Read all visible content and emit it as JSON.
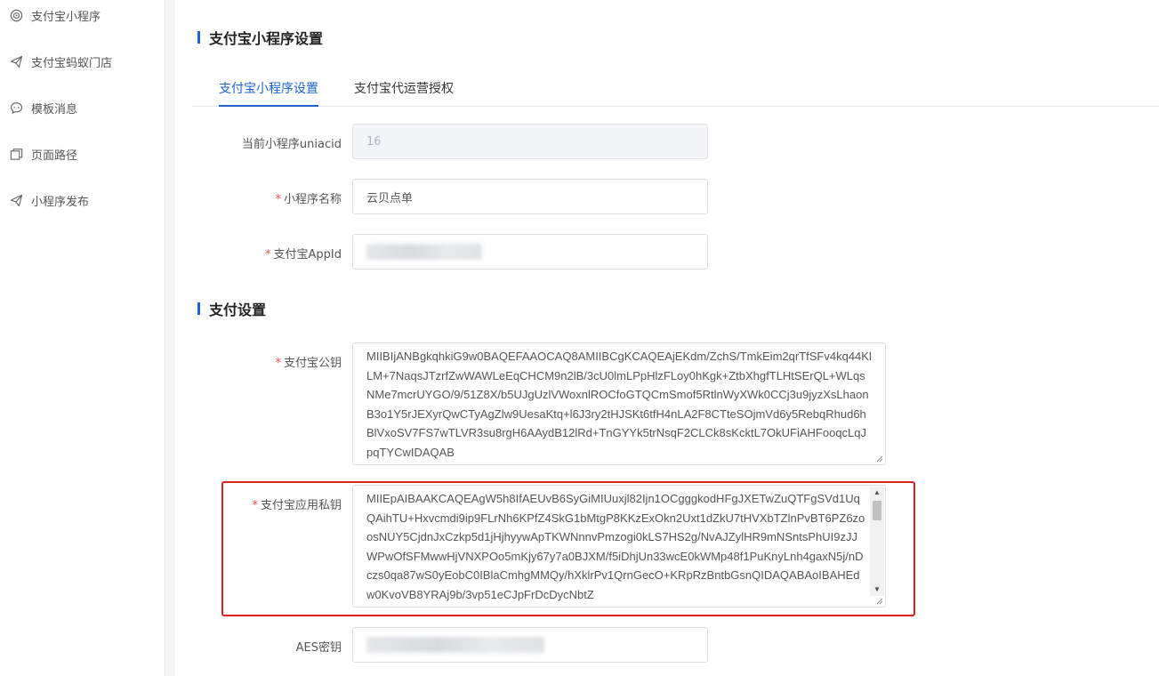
{
  "sidebar": {
    "items": [
      {
        "label": "支付宝小程序",
        "icon": "alipay-miniapp-icon"
      },
      {
        "label": "支付宝蚂蚁门店",
        "icon": "paper-plane-icon"
      },
      {
        "label": "模板消息",
        "icon": "chat-bubble-icon"
      },
      {
        "label": "页面路径",
        "icon": "pages-icon"
      },
      {
        "label": "小程序发布",
        "icon": "paper-plane-icon"
      }
    ]
  },
  "main": {
    "section1_title": "支付宝小程序设置",
    "tabs": [
      {
        "label": "支付宝小程序设置",
        "active": true
      },
      {
        "label": "支付宝代运营授权",
        "active": false
      }
    ],
    "fields": {
      "uniacid": {
        "label": "当前小程序uniacid",
        "value": "16"
      },
      "name": {
        "label": "小程序名称",
        "required": "*",
        "value": "云贝点单"
      },
      "appid": {
        "label": "支付宝AppId",
        "required": "*"
      }
    },
    "section2_title": "支付设置",
    "pay": {
      "public_key": {
        "label": "支付宝公钥",
        "required": "*",
        "value": "MIIBIjANBgkqhkiG9w0BAQEFAAOCAQ8AMIIBCgKCAQEAjEKdm/ZchS/TmkEim2qrTfSFv4kq44KlLM+7NaqsJTzrfZwWAWLeEqCHCM9n2lB/3cU0lmLPpHlzFLoy0hKgk+ZtbXhgfTLHtSErQL+WLqsNMe7mcrUYGO/9/51Z8X/b5UJgUzlVWoxnlROCfoGTQCmSmof5RtlnWyXWk0CCj3u9jyzXsLhaonB3o1Y5rJEXyrQwCTyAgZlw9UesaKtq+l6J3ry2tHJSKt6tfH4nLA2F8CTteSOjmVd6y5RebqRhud6hBlVxoSV7FS7wTLVR3su8rgH6AAydB12lRd+TnGYYk5trNsqF2CLCk8sKcktL7OkUFiAHFooqcLqJpqTYCwIDAQAB"
      },
      "private_key": {
        "label": "支付宝应用私钥",
        "required": "*",
        "value": "MIIEpAIBAAKCAQEAgW5h8IfAEUvB6SyGiMIUuxjl82Ijn1OCgggkodHFgJXETwZuQTFgSVd1UqQAihTU+Hxvcmdi9ip9FLrNh6KPfZ4SkG1bMtgP8KKzExOkn2Uxt1dZkU7tHVXbTZlnPvBT6PZ6zoosNUY5CjdnJxCzkp5d1jHjhyywApTKWNnnvPmzogi0kLS7HS2g/NvAJZylHR9mNSntsPhUI9zJJWPwOfSFMwwHjVNXPOo5mKjy67y7a0BJXM/f5iDhjUn33wcE0kWMp48f1PuKnyLnh4gaxN5j/nDczs0qa87wS0yEobC0IBlaCmhgMMQy/hXklrPv1QrnGecO+KRpRzBntbGsnQIDAQABAoIBAHEdw0KvoVB8YRAj9b/3vp51eCJpFrDcDycNbtZ"
      },
      "aes": {
        "label": "AES密钥"
      }
    }
  },
  "colors": {
    "accent": "#1c63d1",
    "required": "#f04a4a",
    "highlight": "#e02020"
  }
}
